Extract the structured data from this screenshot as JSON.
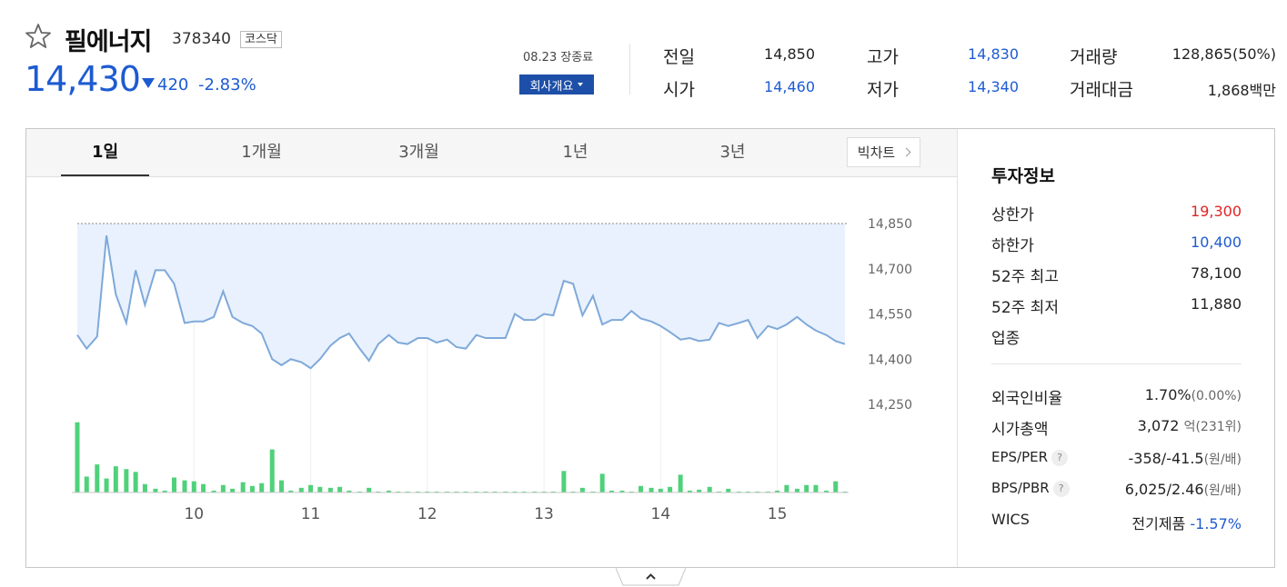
{
  "header": {
    "name": "필에너지",
    "code": "378340",
    "market": "코스닥",
    "price": "14,430",
    "change": "420",
    "change_pct": "-2.83%",
    "close_date": "08.23 장종료",
    "company_button": "회사개요"
  },
  "quotes": {
    "prev_close": {
      "label": "전일",
      "value": "14,850"
    },
    "open": {
      "label": "시가",
      "value": "14,460"
    },
    "high": {
      "label": "고가",
      "value": "14,830"
    },
    "low": {
      "label": "저가",
      "value": "14,340"
    },
    "volume": {
      "label": "거래량",
      "value": "128,865(50%)"
    },
    "amount": {
      "label": "거래대금",
      "value": "1,868백만"
    }
  },
  "tabs": [
    "1일",
    "1개월",
    "3개월",
    "1년",
    "3년"
  ],
  "active_tab": "1일",
  "big_chart_button": "빅차트",
  "invest": {
    "title": "투자정보",
    "upper_limit": {
      "label": "상한가",
      "value": "19,300"
    },
    "lower_limit": {
      "label": "하한가",
      "value": "10,400"
    },
    "high52": {
      "label": "52주 최고",
      "value": "78,100"
    },
    "low52": {
      "label": "52주 최저",
      "value": "11,880"
    },
    "industry": {
      "label": "업종",
      "value": ""
    },
    "foreign_ratio": {
      "label": "외국인비율",
      "value": "1.70%",
      "extra": "(0.00%)"
    },
    "market_cap": {
      "label": "시가총액",
      "value": "3,072",
      "unit": "억",
      "extra": "(231위)"
    },
    "eps_per": {
      "label": "EPS/PER",
      "value": "-358/-41.5",
      "unit": "(원/배)"
    },
    "bps_pbr": {
      "label": "BPS/PBR",
      "value": "6,025/2.46",
      "unit": "(원/배)"
    },
    "wics": {
      "label": "WICS",
      "value": "전기제품",
      "extra": "-1.57%"
    },
    "help_icon": "?"
  },
  "colors": {
    "up": "#e02424",
    "down": "#1d5bd1",
    "line": "#7fa9d9",
    "area": "#e8f1fd",
    "volume": "#4fd17a"
  },
  "icons": [
    "star-outline-icon",
    "caret-down-icon",
    "chevron-right-icon",
    "question-icon",
    "chevron-up-icon"
  ],
  "chart_data": {
    "type": "line",
    "y_ticks": [
      "14,850",
      "14,700",
      "14,550",
      "14,400",
      "14,250"
    ],
    "ylim": [
      14250,
      14850
    ],
    "reference_line": 14850,
    "x_ticks": [
      "10",
      "11",
      "12",
      "13",
      "14",
      "15"
    ],
    "x_tick_times": [
      10,
      11,
      12,
      13,
      14,
      15
    ],
    "times": [
      9.0,
      9.08,
      9.17,
      9.25,
      9.33,
      9.42,
      9.5,
      9.58,
      9.67,
      9.75,
      9.83,
      9.92,
      10.0,
      10.08,
      10.17,
      10.25,
      10.33,
      10.42,
      10.5,
      10.58,
      10.67,
      10.75,
      10.83,
      10.92,
      11.0,
      11.08,
      11.17,
      11.25,
      11.33,
      11.42,
      11.5,
      11.58,
      11.67,
      11.75,
      11.83,
      11.92,
      12.0,
      12.08,
      12.17,
      12.25,
      12.33,
      12.42,
      12.5,
      12.58,
      12.67,
      12.75,
      12.83,
      12.92,
      13.0,
      13.08,
      13.17,
      13.25,
      13.33,
      13.42,
      13.5,
      13.58,
      13.67,
      13.75,
      13.83,
      13.92,
      14.0,
      14.08,
      14.17,
      14.25,
      14.33,
      14.42,
      14.5,
      14.58,
      14.67,
      14.75,
      14.83,
      14.92,
      15.0,
      15.08,
      15.17,
      15.25,
      15.33,
      15.42,
      15.5,
      15.58
    ],
    "price": [
      14480,
      14435,
      14475,
      14810,
      14615,
      14520,
      14695,
      14580,
      14695,
      14695,
      14650,
      14520,
      14525,
      14525,
      14540,
      14625,
      14540,
      14520,
      14510,
      14485,
      14400,
      14380,
      14400,
      14390,
      14370,
      14400,
      14445,
      14470,
      14485,
      14435,
      14395,
      14450,
      14480,
      14455,
      14450,
      14470,
      14470,
      14455,
      14465,
      14440,
      14435,
      14480,
      14470,
      14470,
      14470,
      14550,
      14530,
      14530,
      14550,
      14545,
      14660,
      14650,
      14545,
      14610,
      14515,
      14530,
      14530,
      14560,
      14535,
      14525,
      14510,
      14490,
      14465,
      14470,
      14460,
      14465,
      14520,
      14510,
      14520,
      14530,
      14470,
      14510,
      14500,
      14515,
      14540,
      14515,
      14495,
      14480,
      14460,
      14450
    ],
    "volume": [
      75,
      17,
      30,
      15,
      28,
      25,
      22,
      9,
      4,
      2,
      16,
      13,
      12,
      9,
      2,
      8,
      4,
      11,
      7,
      10,
      46,
      13,
      2,
      5,
      8,
      6,
      5,
      6,
      2,
      1,
      5,
      1,
      2,
      1,
      1,
      1,
      1,
      1,
      1,
      1,
      1,
      1,
      1,
      1,
      1,
      1,
      1,
      1,
      1,
      1,
      23,
      1,
      5,
      1,
      20,
      2,
      2,
      1,
      7,
      5,
      4,
      6,
      19,
      2,
      3,
      6,
      1,
      4,
      1,
      1,
      1,
      1,
      2,
      8,
      4,
      8,
      8,
      2,
      12,
      1
    ]
  }
}
